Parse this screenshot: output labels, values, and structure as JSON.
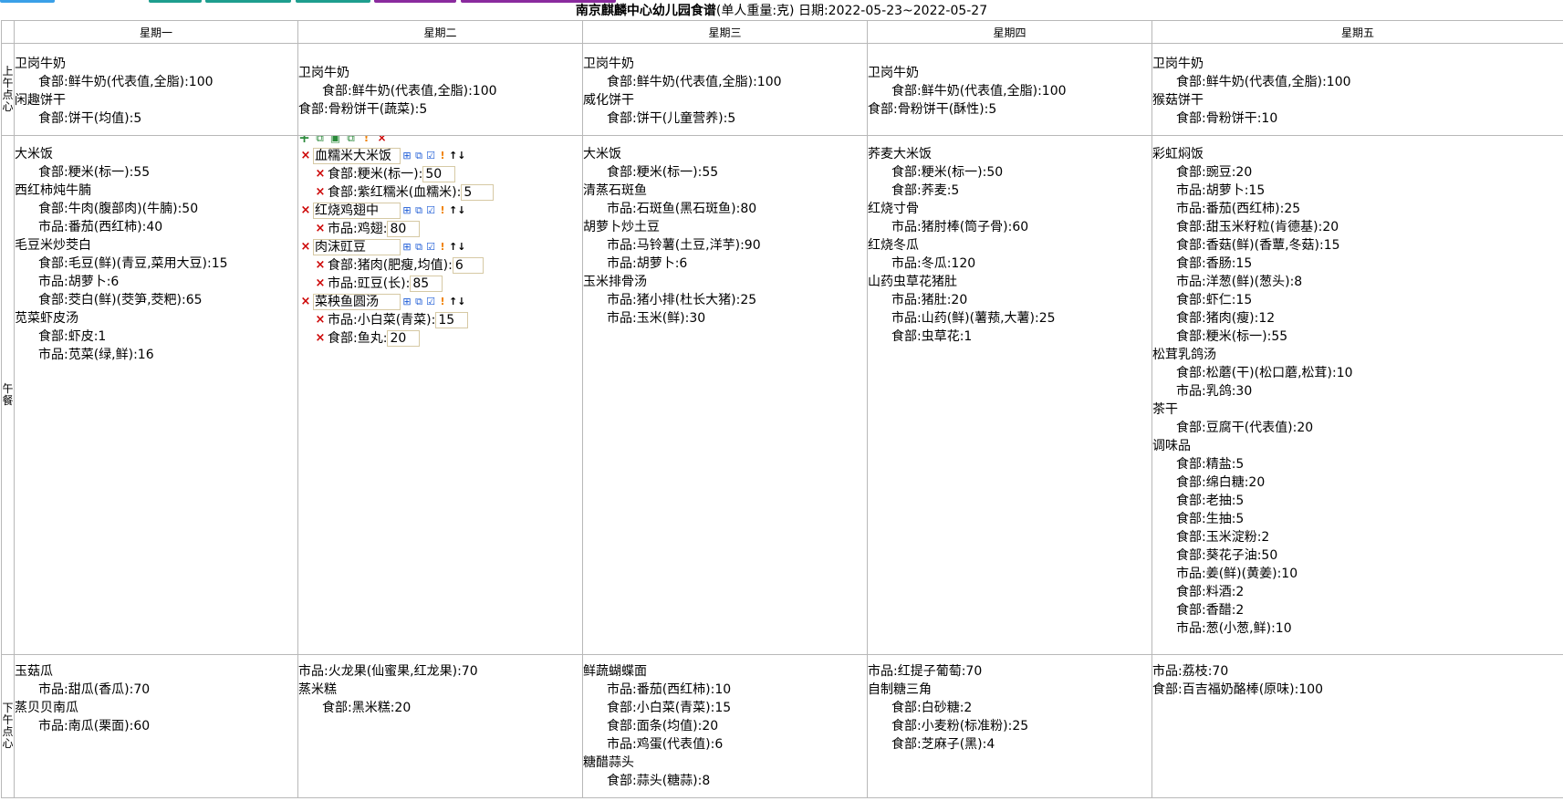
{
  "title": {
    "school": "南京麒麟中心幼儿园食谱",
    "unit": "(单人重量:克)",
    "date": " 日期:2022-05-23~2022-05-27"
  },
  "colors": {
    "tab_blue": "#3aa0e8",
    "tab_teal": "#1e9e8e",
    "tab_purple": "#8a2a9e",
    "border": "#b8b8b8",
    "input_border": "#d6c9a4",
    "delete": "#cc0000",
    "add": "#2a8a3a",
    "warn": "#f08000"
  },
  "days": [
    "星期一",
    "星期二",
    "星期三",
    "星期四",
    "星期五"
  ],
  "meals": [
    "上午点心",
    "午餐",
    "下午点心"
  ],
  "menu": {
    "am": [
      [
        {
          "dish": "卫岗牛奶",
          "ings": [
            "食部:鲜牛奶(代表值,全脂):100"
          ]
        },
        {
          "dish": "闲趣饼干",
          "ings": [
            "食部:饼干(均值):5"
          ]
        }
      ],
      [
        {
          "dish": "卫岗牛奶",
          "ings": [
            "食部:鲜牛奶(代表值,全脂):100"
          ]
        },
        {
          "dish": "食部:骨粉饼干(蔬菜):5",
          "ings": []
        }
      ],
      [
        {
          "dish": "卫岗牛奶",
          "ings": [
            "食部:鲜牛奶(代表值,全脂):100"
          ]
        },
        {
          "dish": "威化饼干",
          "ings": [
            "食部:饼干(儿童营养):5"
          ]
        }
      ],
      [
        {
          "dish": "卫岗牛奶",
          "ings": [
            "食部:鲜牛奶(代表值,全脂):100"
          ]
        },
        {
          "dish": "食部:骨粉饼干(酥性):5",
          "ings": []
        }
      ],
      [
        {
          "dish": "卫岗牛奶",
          "ings": [
            "食部:鲜牛奶(代表值,全脂):100"
          ]
        },
        {
          "dish": "猴菇饼干",
          "ings": [
            "食部:骨粉饼干:10"
          ]
        }
      ]
    ],
    "lunch": [
      [
        {
          "dish": "大米饭",
          "ings": [
            "食部:粳米(标一):55"
          ]
        },
        {
          "dish": "西红柿炖牛腩",
          "ings": [
            "食部:牛肉(腹部肉)(牛腩):50",
            "市品:番茄(西红柿):40"
          ]
        },
        {
          "dish": "毛豆米炒茭白",
          "ings": [
            "食部:毛豆(鲜)(青豆,菜用大豆):15",
            "市品:胡萝卜:6",
            "食部:茭白(鲜)(茭笋,茭粑):65"
          ]
        },
        {
          "dish": "苋菜虾皮汤",
          "ings": [
            "食部:虾皮:1",
            "市品:苋菜(绿,鲜):16"
          ]
        }
      ],
      [],
      [
        {
          "dish": "大米饭",
          "ings": [
            "食部:粳米(标一):55"
          ]
        },
        {
          "dish": "清蒸石斑鱼",
          "ings": [
            "市品:石斑鱼(黑石斑鱼):80"
          ]
        },
        {
          "dish": "胡萝卜炒土豆",
          "ings": [
            "市品:马铃薯(土豆,洋芋):90",
            "市品:胡萝卜:6"
          ]
        },
        {
          "dish": "玉米排骨汤",
          "ings": [
            "市品:猪小排(杜长大猪):25",
            "市品:玉米(鲜):30"
          ]
        }
      ],
      [
        {
          "dish": "荞麦大米饭",
          "ings": [
            "食部:粳米(标一):50",
            "食部:荞麦:5"
          ]
        },
        {
          "dish": "红烧寸骨",
          "ings": [
            "市品:猪肘棒(筒子骨):60"
          ]
        },
        {
          "dish": "红烧冬瓜",
          "ings": [
            "市品:冬瓜:120"
          ]
        },
        {
          "dish": "山药虫草花猪肚",
          "ings": [
            "市品:猪肚:20",
            "市品:山药(鲜)(薯蓣,大薯):25",
            "食部:虫草花:1"
          ]
        }
      ],
      [
        {
          "dish": "彩虹焖饭",
          "ings": [
            "食部:豌豆:20",
            "市品:胡萝卜:15",
            "市品:番茄(西红柿):25",
            "食部:甜玉米籽粒(肯德基):20",
            "食部:香菇(鲜)(香蕈,冬菇):15",
            "食部:香肠:15",
            "市品:洋葱(鲜)(葱头):8",
            "食部:虾仁:15",
            "食部:猪肉(瘦):12",
            "食部:粳米(标一):55"
          ]
        },
        {
          "dish": "松茸乳鸽汤",
          "ings": [
            "食部:松蘑(干)(松口蘑,松茸):10",
            "市品:乳鸽:30"
          ]
        },
        {
          "dish": "茶干",
          "ings": [
            "食部:豆腐干(代表值):20"
          ]
        },
        {
          "dish": "调味品",
          "ings": [
            "食部:精盐:5",
            "食部:绵白糖:20",
            "食部:老抽:5",
            "食部:生抽:5",
            "食部:玉米淀粉:2",
            "食部:葵花子油:50",
            "市品:姜(鲜)(黄姜):10",
            "食部:料酒:2",
            "食部:香醋:2",
            "市品:葱(小葱,鲜):10"
          ]
        }
      ]
    ],
    "edit": [
      {
        "dish": "血糯米大米饭",
        "ings": [
          {
            "label": "食部:粳米(标一):",
            "qty": "50"
          },
          {
            "label": "食部:紫红糯米(血糯米):",
            "qty": "5"
          }
        ]
      },
      {
        "dish": "红烧鸡翅中",
        "ings": [
          {
            "label": "市品:鸡翅:",
            "qty": "80"
          }
        ]
      },
      {
        "dish": "肉沫豇豆",
        "ings": [
          {
            "label": "食部:猪肉(肥瘦,均值):",
            "qty": "6"
          },
          {
            "label": "市品:豇豆(长):",
            "qty": "85"
          }
        ]
      },
      {
        "dish": "菜秧鱼圆汤",
        "ings": [
          {
            "label": "市品:小白菜(青菜):",
            "qty": "15"
          },
          {
            "label": "食部:鱼丸:",
            "qty": "20"
          }
        ]
      }
    ],
    "pm": [
      [
        {
          "dish": "玉菇瓜",
          "ings": [
            "市品:甜瓜(香瓜):70"
          ]
        },
        {
          "dish": "蒸贝贝南瓜",
          "ings": [
            "市品:南瓜(栗面):60"
          ]
        }
      ],
      [
        {
          "dish": "市品:火龙果(仙蜜果,红龙果):70",
          "ings": []
        },
        {
          "dish": "蒸米糕",
          "ings": [
            "食部:黑米糕:20"
          ]
        }
      ],
      [
        {
          "dish": "鲜蔬蝴蝶面",
          "ings": [
            "市品:番茄(西红柿):10",
            "食部:小白菜(青菜):15",
            "食部:面条(均值):20",
            "市品:鸡蛋(代表值):6"
          ]
        },
        {
          "dish": "糖醋蒜头",
          "ings": [
            "食部:蒜头(糖蒜):8"
          ]
        }
      ],
      [
        {
          "dish": "市品:红提子葡萄:70",
          "ings": []
        },
        {
          "dish": "自制糖三角",
          "ings": [
            "食部:白砂糖:2",
            "食部:小麦粉(标准粉):25",
            "食部:芝麻子(黑):4"
          ]
        }
      ],
      [
        {
          "dish": "市品:荔枝:70",
          "ings": []
        },
        {
          "dish": "食部:百吉福奶酪棒(原味):100",
          "ings": []
        }
      ]
    ]
  }
}
